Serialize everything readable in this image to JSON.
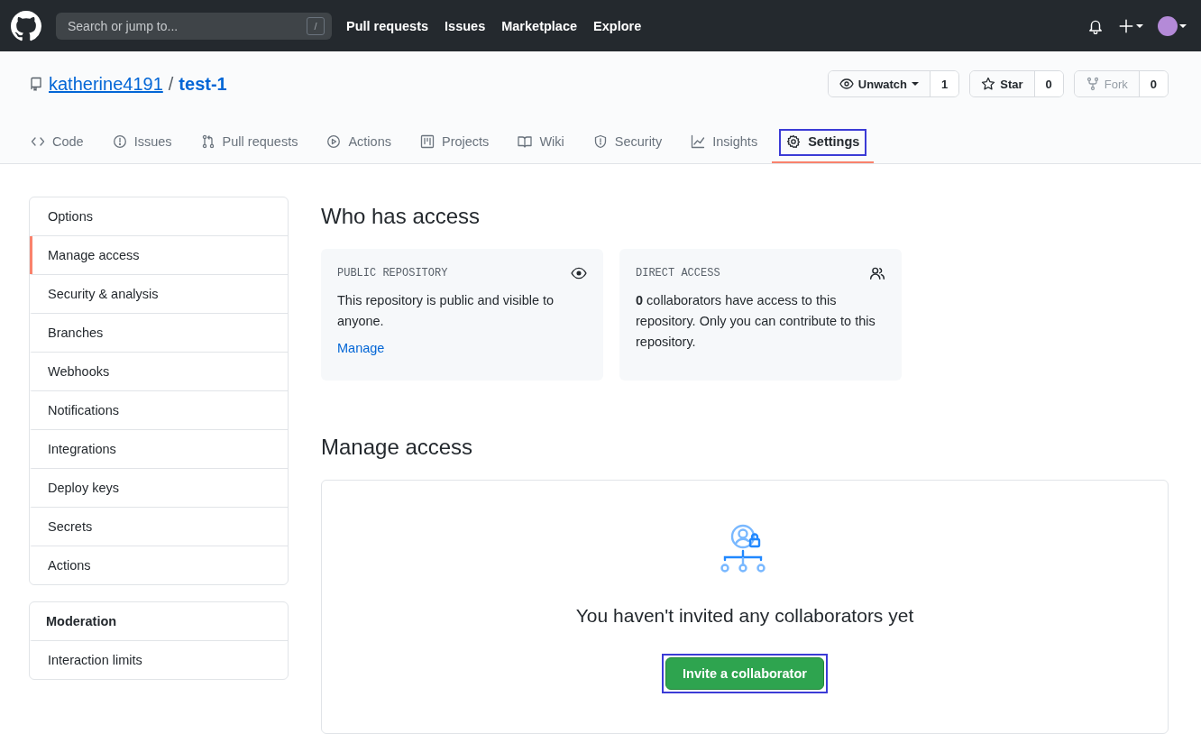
{
  "header": {
    "search": {
      "placeholder": "Search or jump to...",
      "shortcut": "/"
    },
    "nav": [
      "Pull requests",
      "Issues",
      "Marketplace",
      "Explore"
    ]
  },
  "repo": {
    "owner": "katherine4191",
    "separator": "/",
    "name": "test-1",
    "actions": [
      {
        "label": "Unwatch",
        "count": "1",
        "disabled": false,
        "dropdown": true
      },
      {
        "label": "Star",
        "count": "0",
        "disabled": false,
        "dropdown": false
      },
      {
        "label": "Fork",
        "count": "0",
        "disabled": true,
        "dropdown": false
      }
    ]
  },
  "tabs": [
    {
      "label": "Code",
      "selected": false,
      "highlighted": false
    },
    {
      "label": "Issues",
      "selected": false,
      "highlighted": false
    },
    {
      "label": "Pull requests",
      "selected": false,
      "highlighted": false
    },
    {
      "label": "Actions",
      "selected": false,
      "highlighted": false
    },
    {
      "label": "Projects",
      "selected": false,
      "highlighted": false
    },
    {
      "label": "Wiki",
      "selected": false,
      "highlighted": false
    },
    {
      "label": "Security",
      "selected": false,
      "highlighted": false
    },
    {
      "label": "Insights",
      "selected": false,
      "highlighted": false
    },
    {
      "label": "Settings",
      "selected": true,
      "highlighted": true
    }
  ],
  "sidebar": {
    "items": [
      {
        "label": "Options",
        "selected": false
      },
      {
        "label": "Manage access",
        "selected": true
      },
      {
        "label": "Security & analysis",
        "selected": false
      },
      {
        "label": "Branches",
        "selected": false
      },
      {
        "label": "Webhooks",
        "selected": false
      },
      {
        "label": "Notifications",
        "selected": false
      },
      {
        "label": "Integrations",
        "selected": false
      },
      {
        "label": "Deploy keys",
        "selected": false
      },
      {
        "label": "Secrets",
        "selected": false
      },
      {
        "label": "Actions",
        "selected": false
      }
    ],
    "moderation": {
      "heading": "Moderation",
      "items": [
        {
          "label": "Interaction limits",
          "selected": false
        }
      ]
    }
  },
  "who_has_access": {
    "title": "Who has access",
    "cards": [
      {
        "title": "PUBLIC REPOSITORY",
        "body": "This repository is public and visible to anyone.",
        "link": "Manage"
      },
      {
        "title": "DIRECT ACCESS",
        "body": "**0** collaborators have access to this repository. Only you can contribute to this repository."
      }
    ]
  },
  "manage_access": {
    "title": "Manage access",
    "message": "You haven't invited any collaborators yet",
    "button": {
      "label": "Invite a collaborator",
      "highlighted": true
    }
  }
}
